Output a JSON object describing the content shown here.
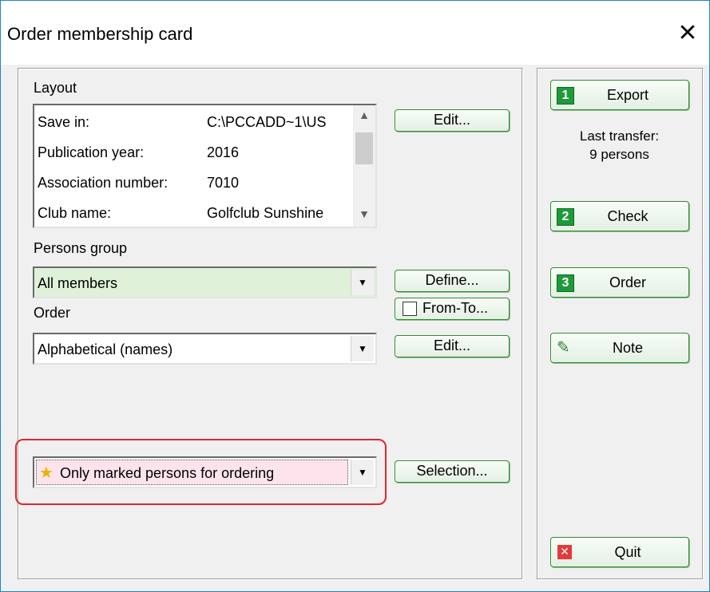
{
  "window": {
    "title": "Order membership card",
    "close_glyph": "✕"
  },
  "layout_section": {
    "label": "Layout",
    "rows": [
      {
        "key": "Save in:",
        "value": "C:\\PCCADD~1\\US"
      },
      {
        "key": "Publication year:",
        "value": "2016"
      },
      {
        "key": "Association number:",
        "value": "7010"
      },
      {
        "key": "Club name:",
        "value": "Golfclub Sunshine"
      }
    ],
    "edit_button": "Edit..."
  },
  "persons_group": {
    "label": "Persons group",
    "value": "All members",
    "define_button": "Define...",
    "from_to_label": "From-To..."
  },
  "order_section": {
    "label": "Order",
    "value": "Alphabetical (names)",
    "edit_button": "Edit..."
  },
  "marked": {
    "value": "Only marked persons for ordering",
    "selection_button": "Selection..."
  },
  "side": {
    "export_button": "Export",
    "export_num": "1",
    "last_transfer_label": "Last transfer:",
    "last_transfer_value": "9 persons",
    "check_button": "Check",
    "check_num": "2",
    "order_button": "Order",
    "order_num": "3",
    "note_button": "Note",
    "quit_button": "Quit"
  },
  "colors": {
    "accent_green": "#1f9a3a",
    "highlight_red": "#e0262a",
    "persons_group_bg": "#dff1d9",
    "marked_bg": "#fde4ec"
  }
}
